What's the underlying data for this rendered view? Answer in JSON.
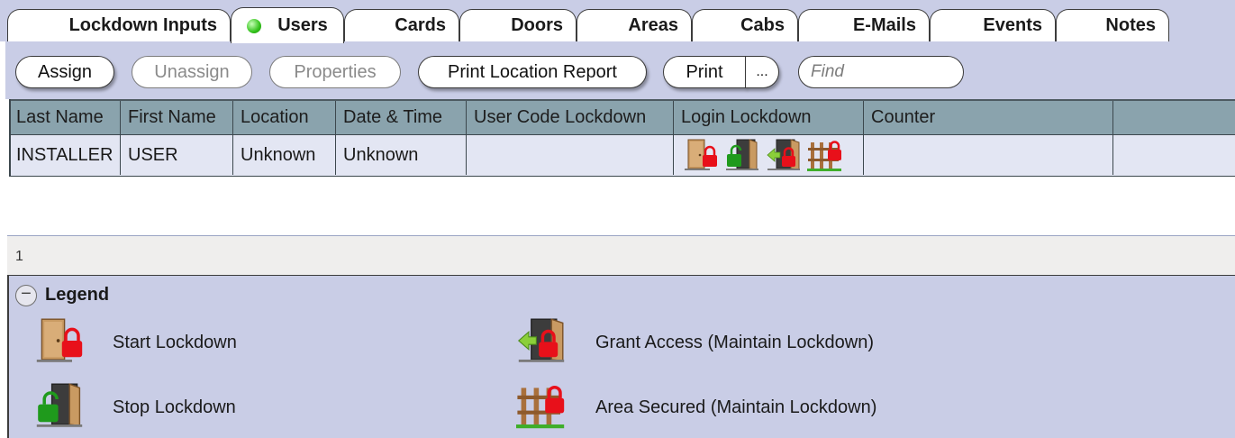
{
  "tabs": [
    {
      "label": "Lockdown Inputs",
      "active": false
    },
    {
      "label": "Users",
      "active": true,
      "status": "online-dot-green"
    },
    {
      "label": "Cards",
      "active": false
    },
    {
      "label": "Doors",
      "active": false
    },
    {
      "label": "Areas",
      "active": false
    },
    {
      "label": "Cabs",
      "active": false
    },
    {
      "label": "E-Mails",
      "active": false
    },
    {
      "label": "Events",
      "active": false
    },
    {
      "label": "Notes",
      "active": false
    }
  ],
  "toolbar": {
    "assign": "Assign",
    "unassign": "Unassign",
    "properties": "Properties",
    "print_location_report": "Print Location Report",
    "print": "Print",
    "print_more": "...",
    "find_placeholder": "Find"
  },
  "table": {
    "columns": [
      "Last Name",
      "First Name",
      "Location",
      "Date & Time",
      "User Code Lockdown",
      "Login Lockdown",
      "Counter",
      ""
    ],
    "rows": [
      {
        "last_name": "INSTALLER",
        "first_name": "USER",
        "location": "Unknown",
        "date_time": "Unknown",
        "user_code_lockdown": "",
        "login_lockdown_icons": [
          "start-lockdown-icon",
          "stop-lockdown-icon",
          "grant-access-icon",
          "area-secured-icon"
        ],
        "counter": ""
      }
    ]
  },
  "status_bar": {
    "record_count": "1"
  },
  "legend": {
    "title": "Legend",
    "toggle_symbol": "−",
    "items": [
      {
        "icon": "start-lockdown-icon",
        "label": "Start Lockdown"
      },
      {
        "icon": "grant-access-icon",
        "label": "Grant Access (Maintain Lockdown)"
      },
      {
        "icon": "stop-lockdown-icon",
        "label": "Stop Lockdown"
      },
      {
        "icon": "area-secured-icon",
        "label": "Area Secured (Maintain Lockdown)"
      }
    ]
  },
  "colors": {
    "panel_bg": "#c9cde6",
    "header_bg": "#8aa3ad",
    "row_bg": "#e3e6f3",
    "lock_red": "#e8101a",
    "arrow_green": "#1f9a1c",
    "door_tan": "#c99a62"
  }
}
